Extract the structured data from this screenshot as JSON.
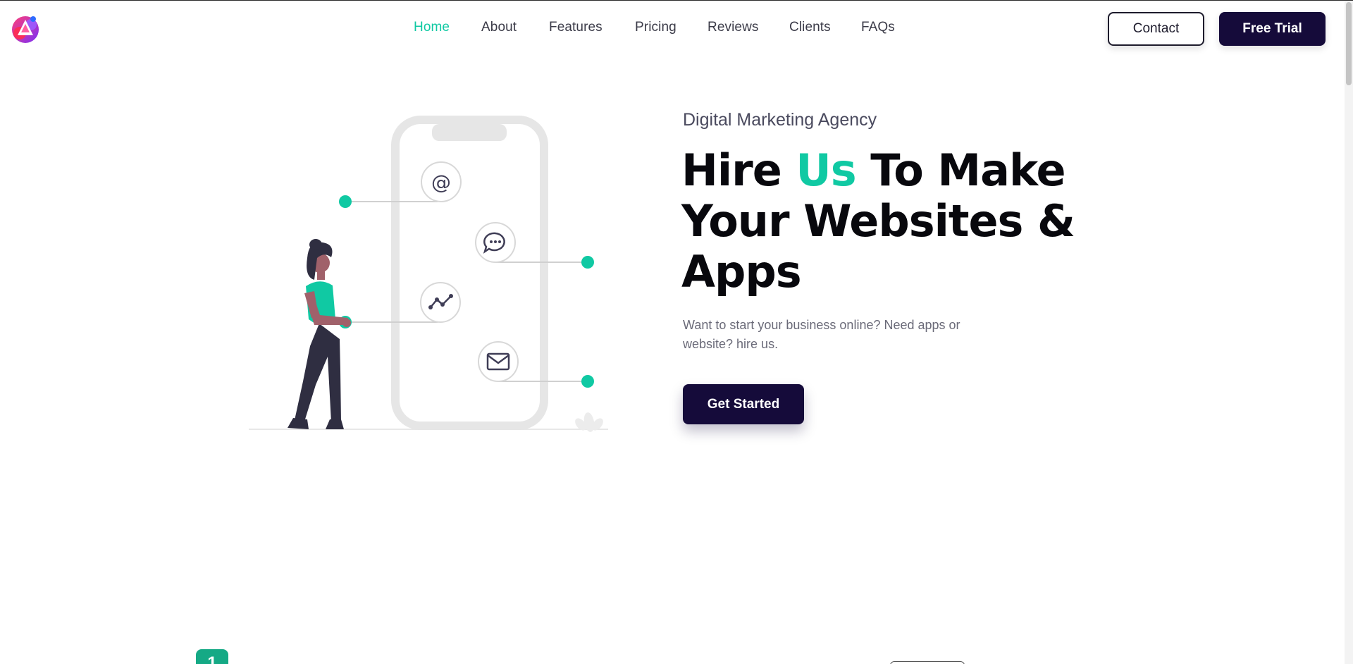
{
  "nav": {
    "items": [
      {
        "label": "Home",
        "active": true
      },
      {
        "label": "About"
      },
      {
        "label": "Features"
      },
      {
        "label": "Pricing"
      },
      {
        "label": "Reviews"
      },
      {
        "label": "Clients"
      },
      {
        "label": "FAQs"
      }
    ],
    "contact_label": "Contact",
    "trial_label": "Free Trial"
  },
  "hero": {
    "eyebrow": "Digital Marketing Agency",
    "headline_part1": "Hire ",
    "headline_accent": "Us",
    "headline_part2": " To Make Your Websites & Apps",
    "subtext": "Want to start your business online? Need apps or website? hire us.",
    "cta_label": "Get Started",
    "icons": [
      "at-sign-icon",
      "chat-bubble-icon",
      "analytics-line-icon",
      "envelope-icon"
    ]
  },
  "next_section": {
    "step_number": "1"
  },
  "colors": {
    "accent": "#10c9a3",
    "dark": "#150b3a",
    "text": "#3b3b48"
  }
}
